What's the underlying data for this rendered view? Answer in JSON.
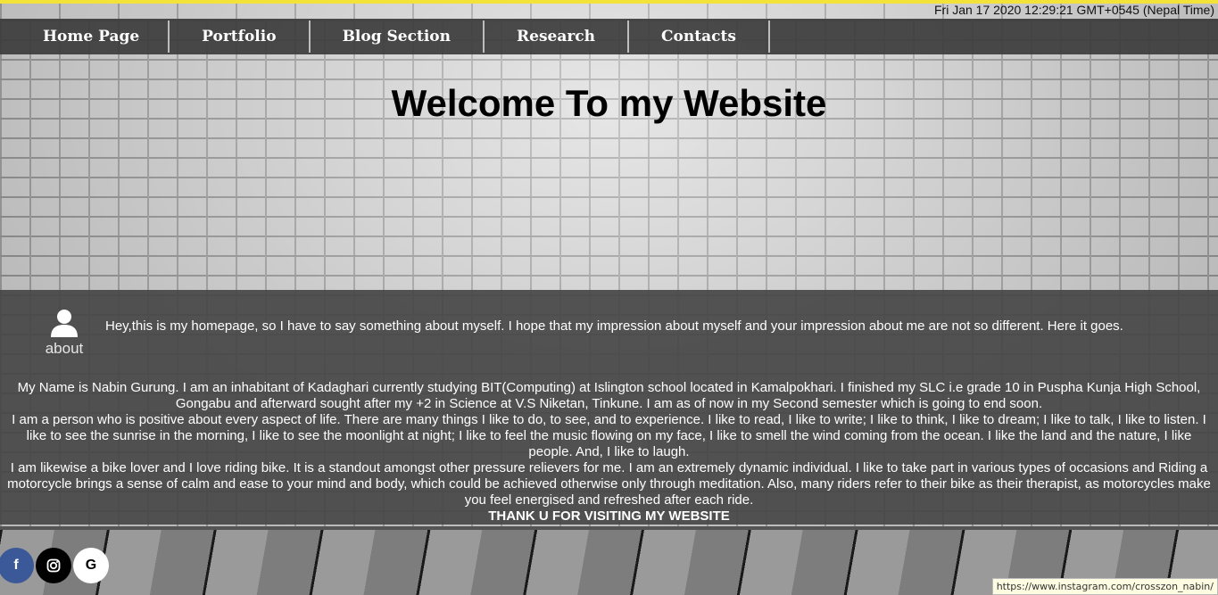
{
  "datetime": "Fri Jan 17 2020 12:29:21 GMT+0545 (Nepal Time)",
  "nav": {
    "items": [
      {
        "label": "Home Page"
      },
      {
        "label": "Portfolio"
      },
      {
        "label": "Blog Section"
      },
      {
        "label": "Research"
      },
      {
        "label": "Contacts"
      }
    ]
  },
  "hero": {
    "title": "Welcome To my Website"
  },
  "about": {
    "label": "about",
    "intro": "Hey,this is my homepage, so I have to say something about myself. I hope that my impression about myself and your impression about me are not so different. Here it goes.",
    "paragraphs": [
      "My Name is Nabin Gurung. I am an inhabitant of Kadaghari currently studying BIT(Computing) at Islington school located in Kamalpokhari. I finished my SLC i.e grade 10 in Puspha Kunja High School, Gongabu and afterward sought after my +2 in Science at V.S Niketan, Tinkune. I am as of now in my Second semester which is going to end soon.",
      "I am a person who is positive about every aspect of life. There are many things I like to do, to see, and to experience. I like to read, I like to write; I like to think, I like to dream; I like to talk, I like to listen. I like to see the sunrise in the morning, I like to see the moonlight at night; I like to feel the music flowing on my face, I like to smell the wind coming from the ocean. I like the land and the nature, I like people. And, I like to laugh.",
      "I am likewise a bike lover and I love riding bike. It is a standout amongst other pressure relievers for me. I am an extremely dynamic individual. I like to take part in various types of occasions and Riding a motorcycle brings a sense of calm and ease to your mind and body, which could be achieved otherwise only through meditation. Also, many riders refer to their bike as their therapist, as motorcycles make you feel energised and refreshed after each ride."
    ],
    "thanks": "THANK U FOR VISITING MY WEBSITE"
  },
  "social": {
    "facebook_glyph": "f",
    "google_glyph": "G",
    "colors": {
      "facebook": "#3b5998",
      "instagram": "#000000",
      "google": "#ffffff"
    }
  },
  "status_bar": {
    "url": "https://www.instagram.com/crosszon_nabin/"
  }
}
